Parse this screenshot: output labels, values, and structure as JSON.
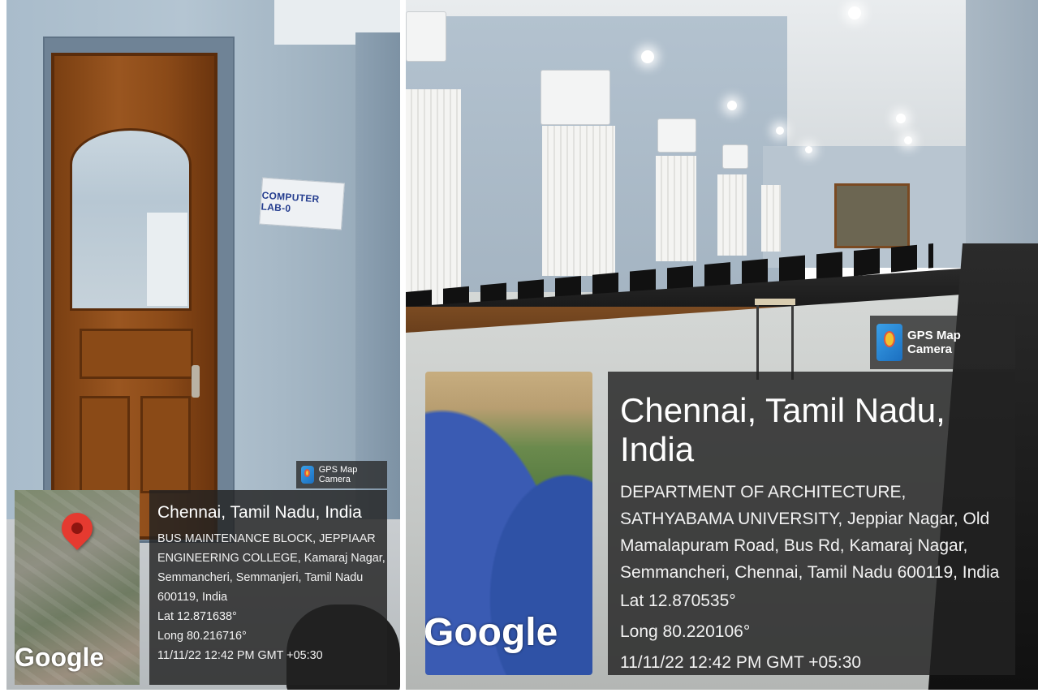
{
  "left_photo": {
    "sign_text": "COMPUTER LAB-0",
    "badge": {
      "label": "GPS Map Camera",
      "icon": "gps-map-camera-icon"
    },
    "location": {
      "city": "Chennai, Tamil Nadu, India",
      "address": "BUS MAINTENANCE BLOCK, JEPPIAAR ENGINEERING COLLEGE, Kamaraj Nagar, Semmancheri, Semmanjeri, Tamil Nadu 600119, India",
      "lat": "Lat 12.871638°",
      "long": "Long 80.216716°",
      "timestamp": "11/11/22 12:42 PM GMT +05:30"
    },
    "map": {
      "watermark": "Google",
      "marker": "map-pin-icon"
    }
  },
  "right_photo": {
    "badge": {
      "label": "GPS Map Camera",
      "icon": "gps-map-camera-icon"
    },
    "location": {
      "city": "Chennai, Tamil Nadu, India",
      "address": "DEPARTMENT OF ARCHITECTURE, SATHYABAMA UNIVERSITY, Jeppiar Nagar, Old Mamalapuram Road, Bus Rd, Kamaraj Nagar, Semmancheri, Chennai, Tamil Nadu 600119, India",
      "lat": "Lat 12.870535°",
      "long": "Long 80.220106°",
      "timestamp": "11/11/22 12:42 PM GMT +05:30"
    },
    "map": {
      "watermark": "Google"
    }
  }
}
